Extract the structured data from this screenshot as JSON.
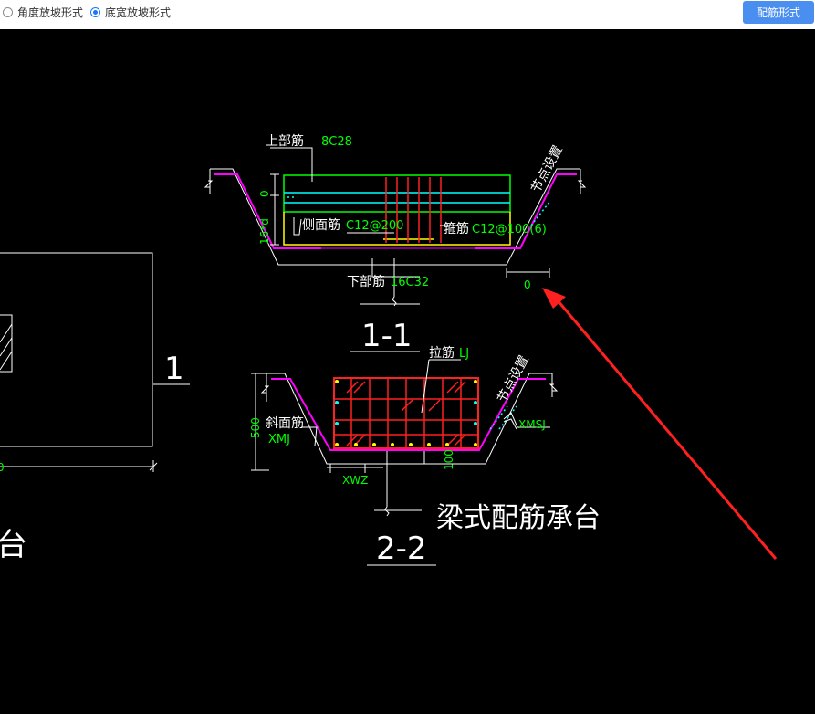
{
  "toolbar": {
    "options": [
      "角度放坡形式",
      "底宽放坡形式"
    ],
    "selected_index": 1,
    "button_label": "配筋形式"
  },
  "drawing": {
    "section1": {
      "title": "1-1",
      "top_bar_label": "上部筋",
      "top_bar_value": "8C28",
      "side_bar_label": "侧面筋",
      "side_bar_value": "C12@200",
      "stirrup_label": "箍筋",
      "stirrup_value": "C12@100(6)",
      "bottom_bar_label": "下部筋",
      "bottom_bar_value": "16C32",
      "node_label": "节点设置",
      "dim_top": "0",
      "dim_side": "16*d",
      "dim_bottom": "0"
    },
    "section2": {
      "title": "2-2",
      "tie_label": "拉筋",
      "tie_value": "LJ",
      "slope_label": "斜面筋",
      "slope_value": "XMJ",
      "node_label": "节点设置",
      "dim_height": "500",
      "dim_width": "XWZ",
      "dim_slope": "XMSJ",
      "dim_bottom": "100"
    },
    "main_title": "梁式配筋承台",
    "left_label": "1",
    "left_dim": "0",
    "left_text": "台"
  },
  "colors": {
    "accent": "#4a8ff0",
    "rebar_red": "#ff2020",
    "outline_green": "#00ff00",
    "cyan": "#00ffff",
    "yellow": "#ffff00",
    "magenta": "#ff00ff"
  }
}
